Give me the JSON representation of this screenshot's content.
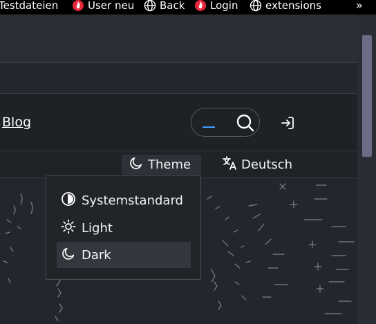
{
  "bookmarks": [
    {
      "label": "Testdateien",
      "icon": "globe-icon"
    },
    {
      "label": "User neu",
      "icon": "fire-icon"
    },
    {
      "label": "Back",
      "icon": "globe-icon"
    },
    {
      "label": "Login",
      "icon": "fire-icon"
    },
    {
      "label": "extensions",
      "icon": "globe-icon"
    }
  ],
  "bookmarks_more": "»",
  "nav": {
    "blog_label": "Blog",
    "search_icon": "search-icon",
    "login_icon": "login-icon"
  },
  "subbar": {
    "theme_label": "Theme",
    "language_label": "Deutsch"
  },
  "theme_menu": {
    "items": [
      {
        "label": "Systemstandard",
        "icon": "half-circle-icon"
      },
      {
        "label": "Light",
        "icon": "sun-icon"
      },
      {
        "label": "Dark",
        "icon": "moon-icon",
        "selected": true
      }
    ]
  },
  "colors": {
    "accent": "#3da0ff",
    "menu_selected": "#34383e",
    "scroll_thumb": "#6b6d86"
  }
}
